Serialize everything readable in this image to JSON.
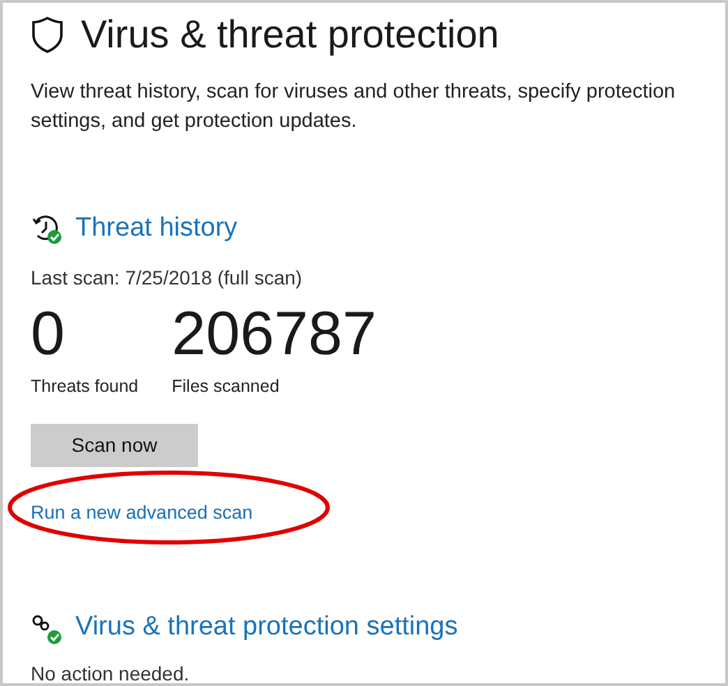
{
  "page": {
    "title": "Virus & threat protection",
    "description": "View threat history, scan for viruses and other threats, specify protection settings, and get protection updates."
  },
  "threat_history": {
    "heading": "Threat history",
    "last_scan": "Last scan: 7/25/2018 (full scan)",
    "stats": [
      {
        "value": "0",
        "label": "Threats found"
      },
      {
        "value": "206787",
        "label": "Files scanned"
      }
    ],
    "scan_button": "Scan now",
    "advanced_scan_link": "Run a new advanced scan",
    "link_circled": true
  },
  "settings": {
    "heading": "Virus & threat protection settings",
    "status": "No action needed."
  }
}
